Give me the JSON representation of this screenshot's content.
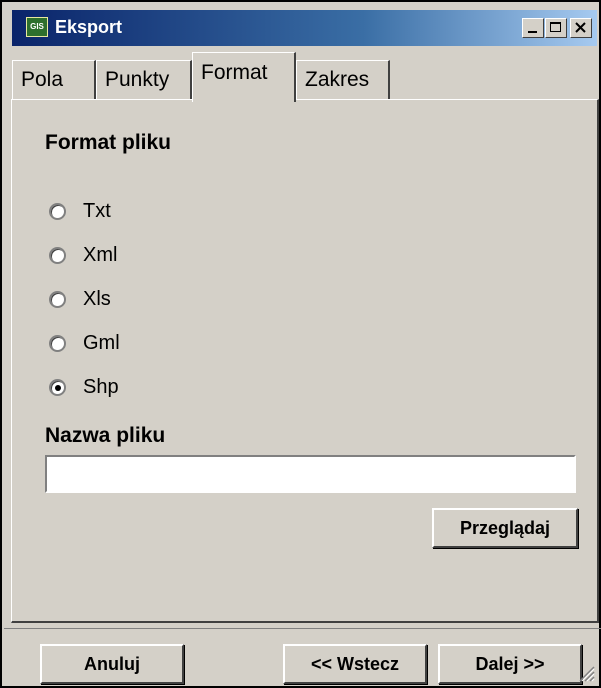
{
  "window": {
    "title": "Eksport",
    "icon": "app-logo-icon",
    "controls": [
      "minimize-icon",
      "maximize-icon",
      "close-icon"
    ]
  },
  "tabs": [
    {
      "label": "Pola",
      "active": false
    },
    {
      "label": "Punkty",
      "active": false
    },
    {
      "label": "Format",
      "active": true
    },
    {
      "label": "Zakres",
      "active": false
    }
  ],
  "format": {
    "heading": "Format pliku",
    "options": [
      {
        "label": "Txt",
        "checked": false
      },
      {
        "label": "Xml",
        "checked": false
      },
      {
        "label": "Xls",
        "checked": false
      },
      {
        "label": "Gml",
        "checked": false
      },
      {
        "label": "Shp",
        "checked": true
      }
    ]
  },
  "filename": {
    "heading": "Nazwa pliku",
    "value": "",
    "browse_label": "Przeglądaj"
  },
  "footer": {
    "cancel_label": "Anuluj",
    "back_label": "<< Wstecz",
    "next_label": "Dalej >>"
  },
  "colors": {
    "window_bg": "#d4d0c8",
    "titlebar_start": "#0a246a",
    "titlebar_end": "#a6caf0"
  }
}
